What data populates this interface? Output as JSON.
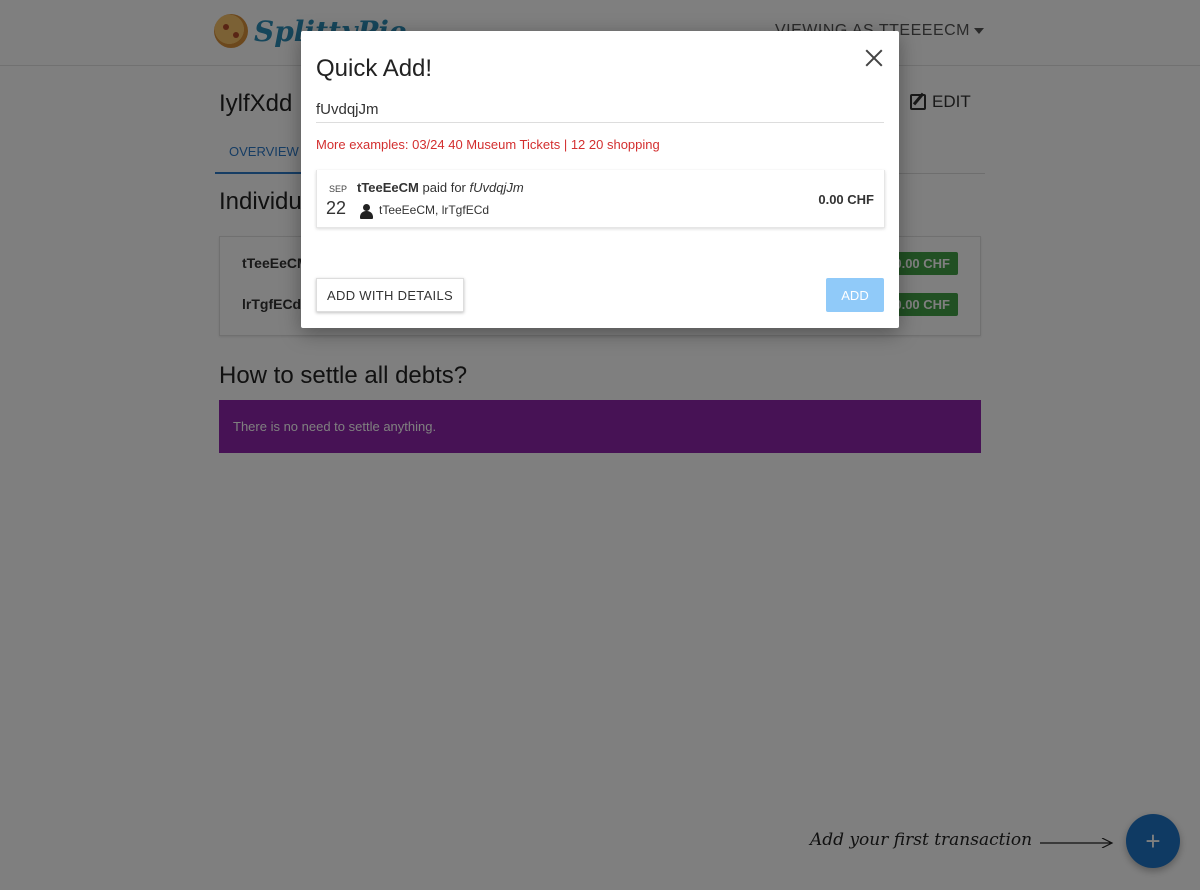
{
  "app": {
    "logo_text": "SplittyPie"
  },
  "navbar": {
    "user_menu": "VIEWING AS TTEEEECM"
  },
  "group": {
    "title": "IylfXdd",
    "edit_label": "EDIT"
  },
  "tabs": [
    {
      "label": "OVERVIEW",
      "active": true
    }
  ],
  "balances": {
    "title": "Individual Balances",
    "rows": [
      {
        "name": "tTeeEeCM",
        "amount": "0.00 CHF"
      },
      {
        "name": "lrTgfECd",
        "amount": "0.00 CHF"
      }
    ]
  },
  "settle": {
    "title": "How to settle all debts?",
    "message": "There is no need to settle anything."
  },
  "hint": {
    "text": "Add your first transaction"
  },
  "fab": {
    "icon": "plus-icon"
  },
  "modal": {
    "title": "Quick Add!",
    "input_value": "fUvdqjJm",
    "examples": "More examples: 03/24 40 Museum Tickets | 12 20 shopping",
    "preview": {
      "month": "SEP",
      "day": "22",
      "payer": "tTeeEeCM",
      "paid_for_text": "paid for",
      "description": "fUvdqjJm",
      "participants": "tTeeEeCM, lrTgfECd",
      "amount": "0.00 CHF"
    },
    "details_button": "ADD WITH DETAILS",
    "add_button": "ADD"
  },
  "colors": {
    "accent": "#1e74c7",
    "settle_bg": "#8e24aa",
    "badge": "#43a047",
    "examples_text": "#d32f2f",
    "add_disabled": "#90caf9"
  }
}
